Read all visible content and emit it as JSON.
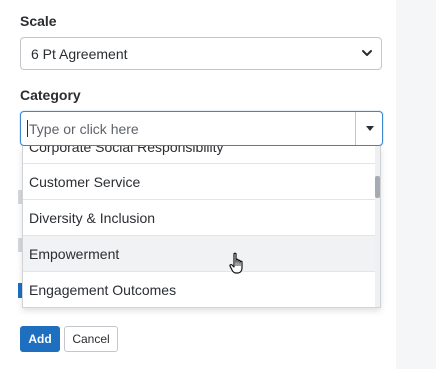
{
  "scale": {
    "label": "Scale",
    "selected": "6 Pt Agreement"
  },
  "category": {
    "label": "Category",
    "placeholder": "Type or click here",
    "options": [
      "Corporate Social Responsibility",
      "Customer Service",
      "Diversity & Inclusion",
      "Empowerment",
      "Engagement Outcomes"
    ],
    "hovered_option": "Empowerment"
  },
  "actions": {
    "add_label": "Add",
    "cancel_label": "Cancel"
  },
  "colors": {
    "accent": "#1f6fc0",
    "focus_border": "#3b88d1"
  },
  "icons": {
    "select_chevron": "chevron-down-icon",
    "dropdown_toggle": "caret-down-icon",
    "cursor": "hand-pointer-icon"
  }
}
